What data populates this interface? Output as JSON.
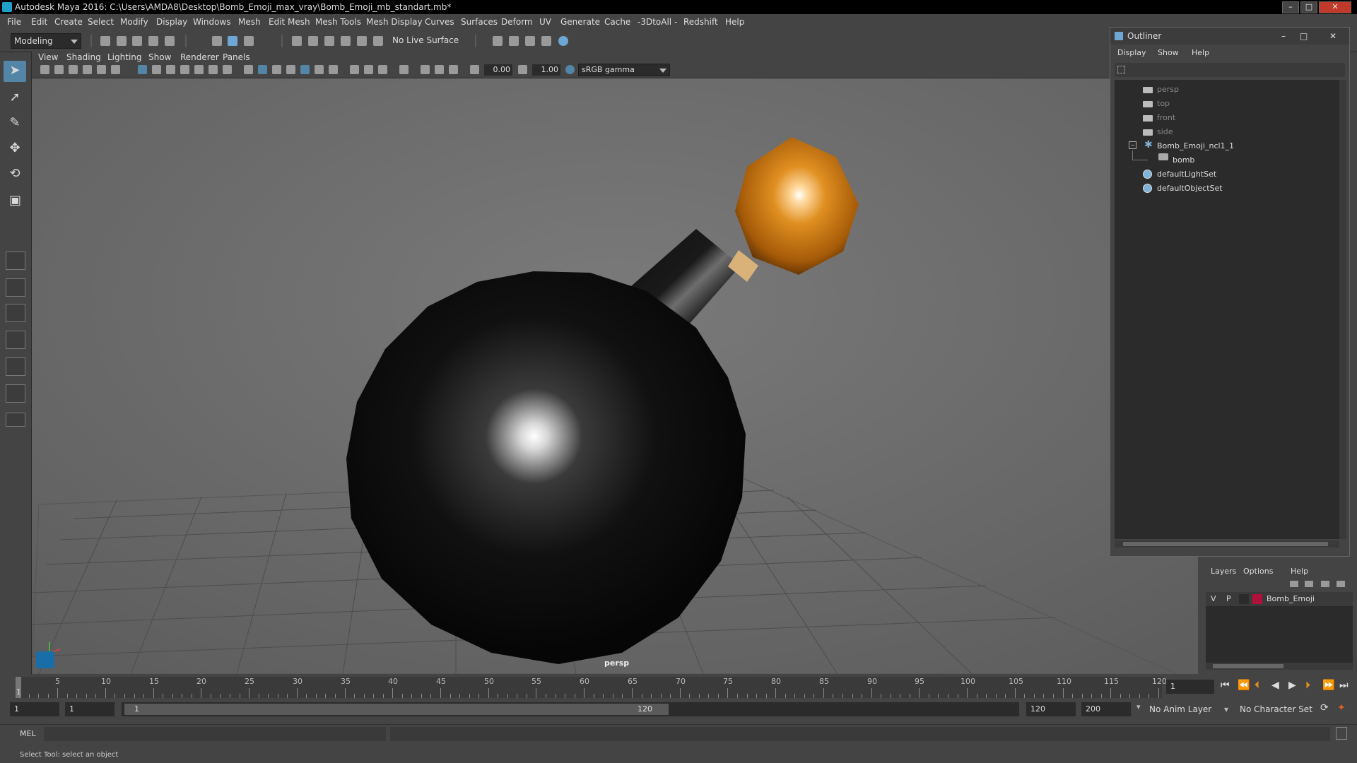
{
  "window": {
    "title": "Autodesk Maya 2016: C:\\Users\\AMDA8\\Desktop\\Bomb_Emoji_max_vray\\Bomb_Emoji_mb_standart.mb*"
  },
  "menubar": {
    "items": [
      "File",
      "Edit",
      "Create",
      "Select",
      "Modify",
      "Display",
      "Windows",
      "Mesh",
      "Edit Mesh",
      "Mesh Tools",
      "Mesh Display",
      "Curves",
      "Surfaces",
      "Deform",
      "UV",
      "Generate",
      "Cache",
      "-3DtoAll -",
      "Redshift",
      "Help"
    ]
  },
  "toolbar": {
    "mode": "Modeling",
    "live_surface": "No Live Surface"
  },
  "viewport": {
    "menu": [
      "View",
      "Shading",
      "Lighting",
      "Show",
      "Renderer",
      "Panels"
    ],
    "exposure": "0.00",
    "gamma": "1.00",
    "color_space": "sRGB gamma",
    "camera_label": "persp"
  },
  "outliner": {
    "title": "Outliner",
    "menu": [
      "Display",
      "Show",
      "Help"
    ],
    "items": [
      {
        "label": "persp"
      },
      {
        "label": "top"
      },
      {
        "label": "front"
      },
      {
        "label": "side"
      },
      {
        "label": "Bomb_Emoji_ncl1_1"
      },
      {
        "label": "bomb"
      },
      {
        "label": "defaultLightSet"
      },
      {
        "label": "defaultObjectSet"
      }
    ]
  },
  "layers": {
    "menu": [
      "Layers",
      "Options",
      "Help"
    ],
    "layer": {
      "v": "V",
      "p": "P",
      "name": "Bomb_Emoji",
      "color": "#b0103a"
    }
  },
  "timeline": {
    "ticks": [
      "5",
      "10",
      "15",
      "20",
      "25",
      "30",
      "35",
      "40",
      "45",
      "50",
      "55",
      "60",
      "65",
      "70",
      "75",
      "80",
      "85",
      "90",
      "95",
      "100",
      "105",
      "110",
      "115",
      "120"
    ],
    "start_marker": "1",
    "current_frame": "1"
  },
  "range": {
    "start": "1",
    "playback_start": "1",
    "slider_start": "1",
    "slider_end": "120",
    "playback_end": "120",
    "end": "200",
    "anim_layer": "No Anim Layer",
    "character_set": "No Character Set"
  },
  "command": {
    "label": "MEL"
  },
  "help": {
    "text": "Select Tool: select an object"
  }
}
